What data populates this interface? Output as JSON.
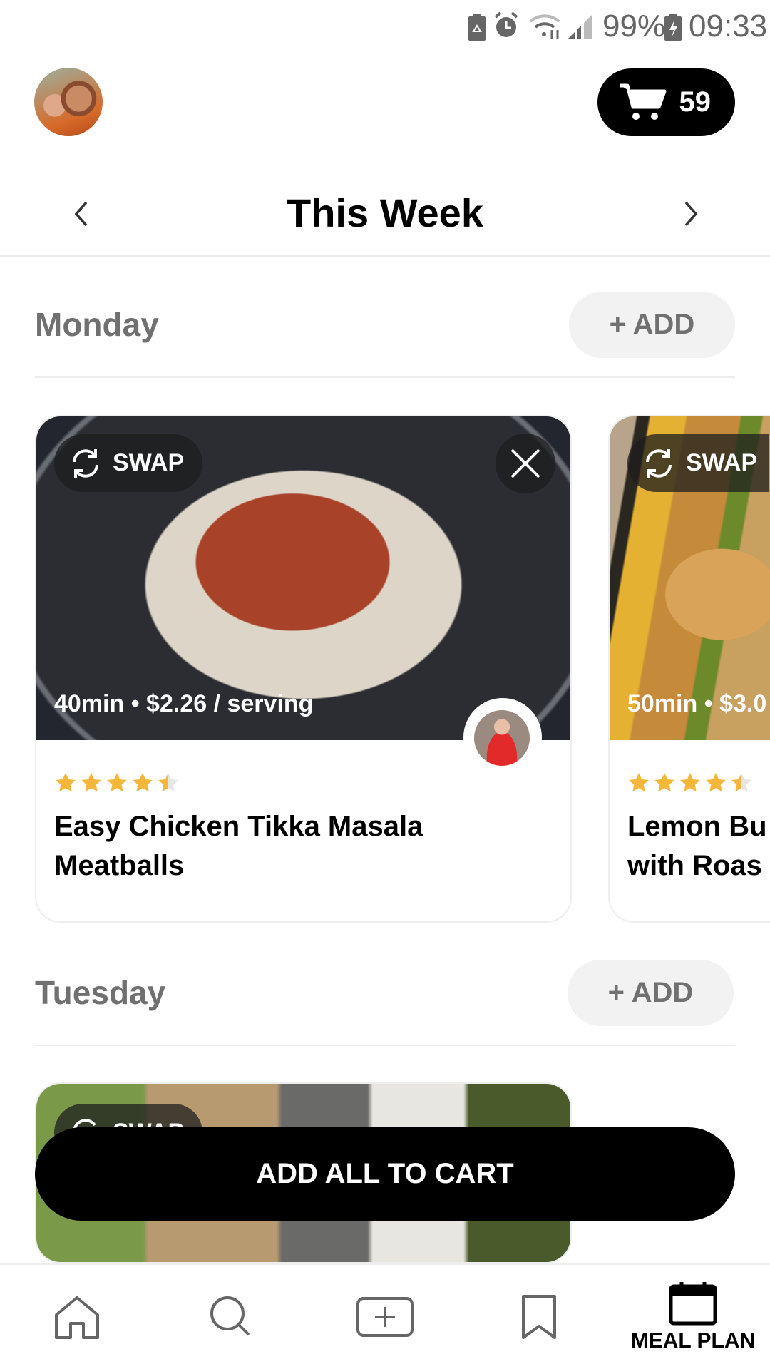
{
  "status_bar": {
    "battery": "99%",
    "time": "09:33",
    "icons": [
      "battery-saver-icon",
      "alarm-icon",
      "wifi-icon",
      "signal-icon",
      "charging-icon"
    ]
  },
  "header": {
    "cart_count": "59",
    "title": "This Week"
  },
  "days": [
    {
      "name": "Monday",
      "add_label": "+ ADD",
      "recipes": [
        {
          "swap_label": "SWAP",
          "meta": "40min • $2.26 / serving",
          "rating": 4.5,
          "title_line1": "Easy Chicken Tikka Masala",
          "title_line2": "Meatballs"
        },
        {
          "swap_label": "SWAP",
          "meta": "50min • $3.0",
          "rating": 4.5,
          "title_line1": "Lemon Bu",
          "title_line2": "with Roas"
        }
      ]
    },
    {
      "name": "Tuesday",
      "add_label": "+ ADD",
      "recipes": [
        {
          "swap_label": "SWAP"
        }
      ]
    }
  ],
  "cta_label": "ADD ALL TO CART",
  "nav": {
    "items": [
      "home",
      "search",
      "add",
      "saved",
      "meal-plan"
    ],
    "active_label": "MEAL PLAN"
  },
  "colors": {
    "star": "#f5b63c",
    "day_text": "#707070",
    "primary": "#000000"
  }
}
